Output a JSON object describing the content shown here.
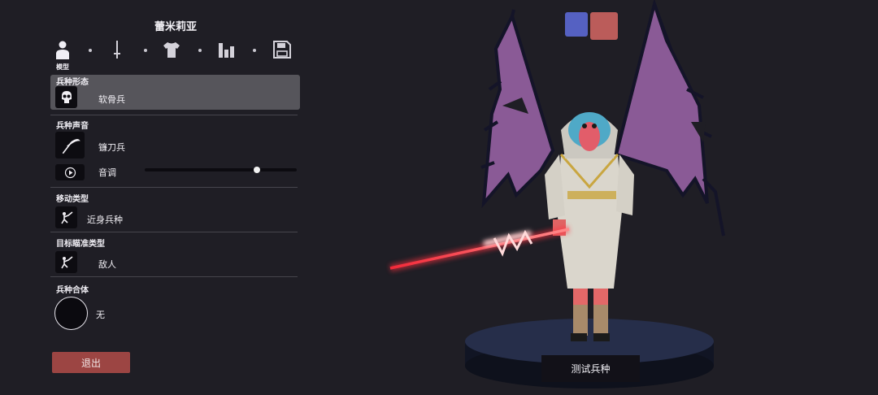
{
  "unit": {
    "name": "蕾米莉亚"
  },
  "tabs": [
    {
      "icon": "person-icon"
    },
    {
      "icon": "sword-icon"
    },
    {
      "icon": "shirt-icon"
    },
    {
      "icon": "stats-icon"
    },
    {
      "icon": "save-icon"
    }
  ],
  "active_tab_label": "模型",
  "sections": {
    "form": {
      "title": "兵种形态",
      "value": "软骨兵",
      "icon": "skeleton-face-icon"
    },
    "voice": {
      "title": "兵种声音",
      "value": "镰刀兵",
      "icon": "scythe-icon",
      "pitch_label": "音调",
      "pitch_level": 0.74,
      "play_icon": "play-icon"
    },
    "movement": {
      "title": "移动类型",
      "value": "近身兵种",
      "icon": "melee-icon"
    },
    "targeting": {
      "title": "目标瞄准类型",
      "value": "敌人",
      "icon": "target-icon"
    },
    "fusion": {
      "title": "兵种合体",
      "value": "无"
    }
  },
  "buttons": {
    "exit": "退出",
    "test": "测试兵种"
  },
  "team_colors": {
    "blue": "#5561c2",
    "red": "#bb5c5a"
  },
  "colors": {
    "background": "#1f1e25",
    "panel_highlight": "#56555b",
    "exit_button": "#9c4543"
  }
}
